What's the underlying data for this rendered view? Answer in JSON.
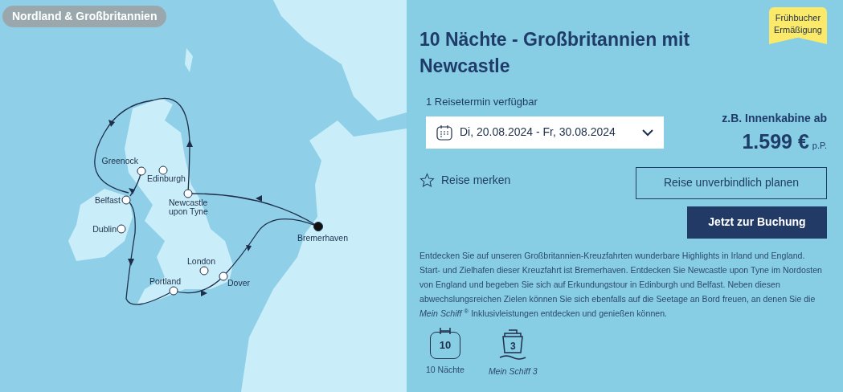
{
  "map": {
    "region_badge": "Nordland & Großbritannien",
    "ports": [
      {
        "name": "Greenock",
        "kind": "stop"
      },
      {
        "name": "Edinburgh",
        "kind": "stop"
      },
      {
        "name": "Belfast",
        "kind": "stop"
      },
      {
        "name": "Newcastle upon Tyne",
        "kind": "stop"
      },
      {
        "name": "Dublin",
        "kind": "stop"
      },
      {
        "name": "Bremerhaven",
        "kind": "home"
      },
      {
        "name": "London",
        "kind": "stop"
      },
      {
        "name": "Portland",
        "kind": "stop"
      },
      {
        "name": "Dover",
        "kind": "stop"
      }
    ]
  },
  "offer": {
    "title": "10 Nächte - Großbritannien mit Newcastle",
    "badge": "Frühbucher Ermäßigung",
    "dates_available": "1 Reisetermin verfügbar",
    "date_select": "Di, 20.08.2024 - Fr, 30.08.2024",
    "price_label": "z.B. Innenkabine ab",
    "price": "1.599 €",
    "price_unit": "p.P.",
    "bookmark": "Reise merken",
    "plan_button": "Reise unverbindlich planen",
    "book_button": "Jetzt zur Buchung",
    "description": "Entdecken Sie auf unseren Großbritannien-Kreuzfahrten wunderbare Highlights in Irland und England. Start- und Zielhafen dieser Kreuzfahrt ist Bremerhaven. Entdecken Sie Newcastle upon Tyne im Nordosten von England und begeben Sie sich auf Erkundungstour in Edinburgh und Belfast. Neben diesen abwechslungsreichen Zielen können Sie sich ebenfalls auf die Seetage an Bord freuen, an denen Sie die *Mein Schiff* $^{®}$ Inklusivleistungen entdecken und genießen können.",
    "facts": [
      {
        "kind": "nights",
        "icon_text": "10",
        "label": "10 Nächte"
      },
      {
        "kind": "ship",
        "icon_text": "3",
        "label": "Mein Schiff 3"
      }
    ]
  }
}
